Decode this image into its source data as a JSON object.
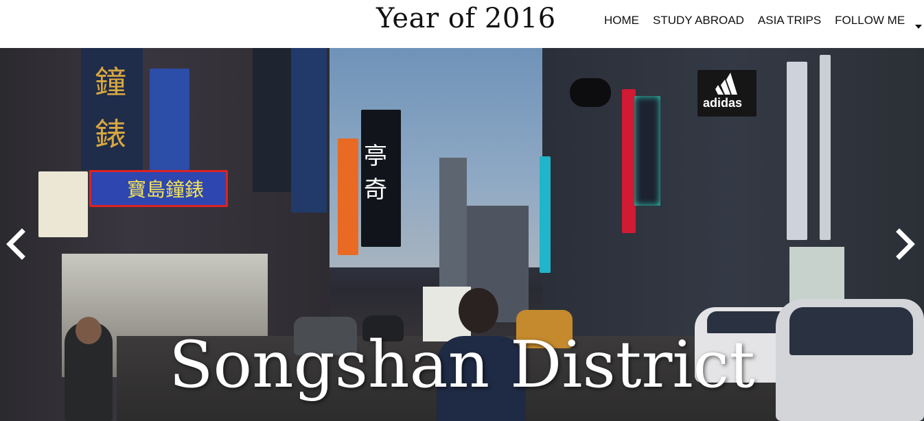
{
  "header": {
    "site_title": "Year of 2016",
    "nav": [
      {
        "label": "HOME"
      },
      {
        "label": "STUDY ABROAD"
      },
      {
        "label": "ASIA TRIPS"
      },
      {
        "label": "FOLLOW ME"
      }
    ],
    "follow_me_dropdown_icon": "caret-down-icon"
  },
  "hero": {
    "caption": "Songshan District",
    "prev_icon": "chevron-left-icon",
    "next_icon": "chevron-right-icon",
    "signage": {
      "s1a": "鐘",
      "s1b": "錶",
      "s3": "寶島鐘錶",
      "s7": "亭奇",
      "s8": "adidas"
    }
  },
  "colors": {
    "caption_text": "#ffffff",
    "nav_text": "#111111",
    "header_bg": "#ffffff"
  }
}
